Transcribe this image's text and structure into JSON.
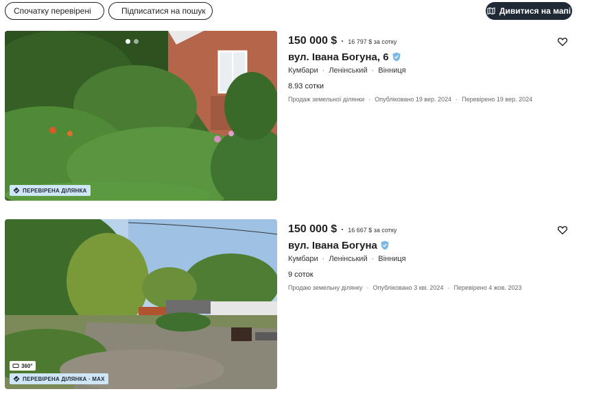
{
  "toolbar": {
    "sort_label": "Спочатку перевірені",
    "subscribe_label": "Підписатися на пошук",
    "map_label": "Дивитися на мапі"
  },
  "listings": [
    {
      "price": "150 000 $",
      "price_per": "16 797 $ за сотку",
      "address": "вул. Івана Богуна, 6",
      "village": "Кумбари",
      "district": "Ленінський",
      "city": "Вінниця",
      "area": "8.93 сотки",
      "type": "Продаж земельної ділянки",
      "published": "Опубліковано 19 вер. 2024",
      "checked": "Перевірено 19 вер. 2024",
      "badge": "ПЕРЕВІРЕНА ДІЛЯНКА"
    },
    {
      "price": "150 000 $",
      "price_per": "16 667 $ за сотку",
      "address": "вул. Івана Богуна",
      "village": "Кумбари",
      "district": "Ленінський",
      "city": "Вінниця",
      "area": "9 соток",
      "type": "Продаю земельну ділянку",
      "published": "Опубліковано 3 кві. 2024",
      "checked": "Перевірено 4 жов. 2023",
      "badge": "ПЕРЕВІРЕНА ДІЛЯНКА · MAX",
      "badge_360": "360°"
    }
  ],
  "colors": {
    "map_button_bg": "#1f2a36",
    "badge_bg": "#cfe6f7",
    "verified_icon": "#7bb8e6"
  },
  "icons": [
    "chevron-down-icon",
    "bell-icon",
    "map-icon",
    "heart-icon",
    "verified-shield-icon",
    "check-badge-icon",
    "panorama-360-icon"
  ]
}
